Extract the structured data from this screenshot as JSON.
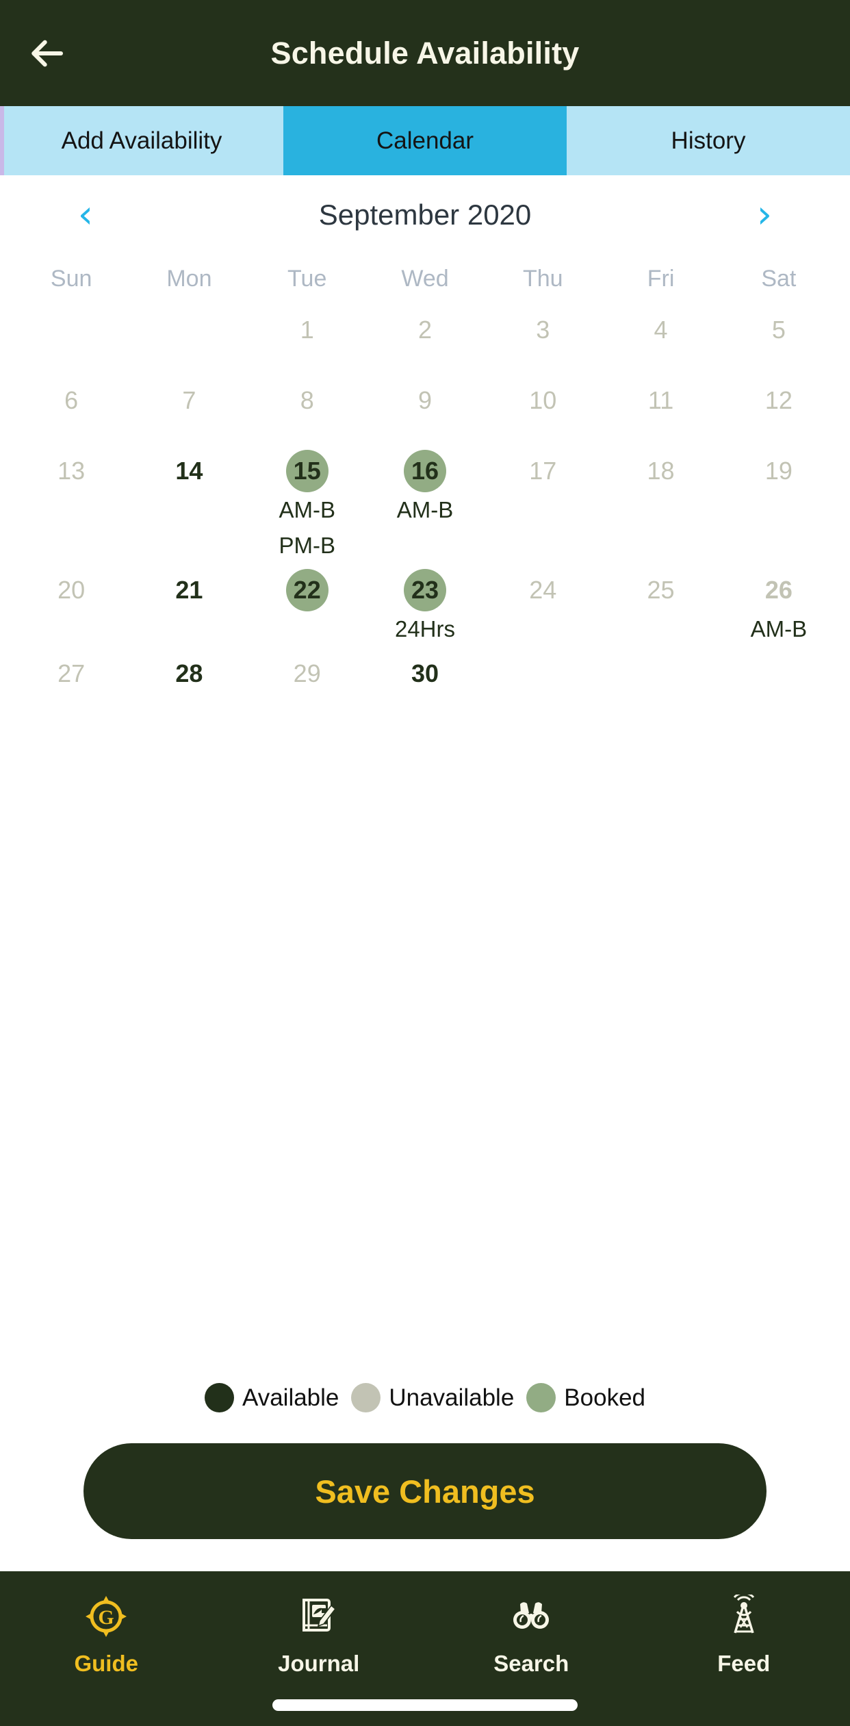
{
  "header": {
    "title": "Schedule Availability",
    "back_icon": "arrow-left-icon",
    "background": "#24311B",
    "text_color": "#F7F6E7"
  },
  "tabs": {
    "active_index": 1,
    "items": [
      {
        "label": "Add Availability"
      },
      {
        "label": "Calendar"
      },
      {
        "label": "History"
      }
    ],
    "inactive_bg": "#B5E4F5",
    "active_bg": "#29B2DF"
  },
  "calendar": {
    "prev_icon": "chevron-left-icon",
    "next_icon": "chevron-right-icon",
    "month_label": "September 2020",
    "weekdays": [
      "Sun",
      "Mon",
      "Tue",
      "Wed",
      "Thu",
      "Fri",
      "Sat"
    ],
    "weeks": [
      [
        {
          "day": "",
          "state": "empty",
          "slots": []
        },
        {
          "day": "",
          "state": "empty",
          "slots": []
        },
        {
          "day": "1",
          "state": "unavailable",
          "slots": []
        },
        {
          "day": "2",
          "state": "unavailable",
          "slots": []
        },
        {
          "day": "3",
          "state": "unavailable",
          "slots": []
        },
        {
          "day": "4",
          "state": "unavailable",
          "slots": []
        },
        {
          "day": "5",
          "state": "unavailable",
          "slots": []
        }
      ],
      [
        {
          "day": "6",
          "state": "unavailable",
          "slots": []
        },
        {
          "day": "7",
          "state": "unavailable",
          "slots": []
        },
        {
          "day": "8",
          "state": "unavailable",
          "slots": []
        },
        {
          "day": "9",
          "state": "unavailable",
          "slots": []
        },
        {
          "day": "10",
          "state": "unavailable",
          "slots": []
        },
        {
          "day": "11",
          "state": "unavailable",
          "slots": []
        },
        {
          "day": "12",
          "state": "unavailable",
          "slots": []
        }
      ],
      [
        {
          "day": "13",
          "state": "unavailable",
          "slots": []
        },
        {
          "day": "14",
          "state": "available",
          "slots": []
        },
        {
          "day": "15",
          "state": "booked",
          "slots": [
            "AM-B",
            "PM-B"
          ]
        },
        {
          "day": "16",
          "state": "booked",
          "slots": [
            "AM-B"
          ]
        },
        {
          "day": "17",
          "state": "unavailable",
          "slots": []
        },
        {
          "day": "18",
          "state": "unavailable",
          "slots": []
        },
        {
          "day": "19",
          "state": "unavailable",
          "slots": []
        }
      ],
      [
        {
          "day": "20",
          "state": "unavailable",
          "slots": []
        },
        {
          "day": "21",
          "state": "available",
          "slots": []
        },
        {
          "day": "22",
          "state": "booked",
          "slots": []
        },
        {
          "day": "23",
          "state": "booked",
          "slots": [
            "24Hrs"
          ]
        },
        {
          "day": "24",
          "state": "unavailable",
          "slots": []
        },
        {
          "day": "25",
          "state": "unavailable",
          "slots": []
        },
        {
          "day": "26",
          "state": "unavail-bold",
          "slots": [
            "AM-B"
          ]
        }
      ],
      [
        {
          "day": "27",
          "state": "unavailable",
          "slots": []
        },
        {
          "day": "28",
          "state": "available",
          "slots": []
        },
        {
          "day": "29",
          "state": "unavailable",
          "slots": []
        },
        {
          "day": "30",
          "state": "available",
          "slots": []
        },
        {
          "day": "",
          "state": "empty",
          "slots": []
        },
        {
          "day": "",
          "state": "empty",
          "slots": []
        },
        {
          "day": "",
          "state": "empty",
          "slots": []
        }
      ]
    ]
  },
  "legend": [
    {
      "label": "Available",
      "color": "#22301A"
    },
    {
      "label": "Unavailable",
      "color": "#C2C3B4"
    },
    {
      "label": "Booked",
      "color": "#92AC84"
    }
  ],
  "save_button": {
    "label": "Save Changes",
    "background": "#24311B",
    "text_color": "#F0BE20"
  },
  "bottom_nav": {
    "active_index": 0,
    "active_color": "#F0BE20",
    "inactive_color": "#F7F6E7",
    "items": [
      {
        "label": "Guide",
        "icon": "compass-g-icon"
      },
      {
        "label": "Journal",
        "icon": "journal-book-pencil-icon"
      },
      {
        "label": "Search",
        "icon": "binoculars-icon"
      },
      {
        "label": "Feed",
        "icon": "broadcast-tower-icon"
      }
    ]
  }
}
